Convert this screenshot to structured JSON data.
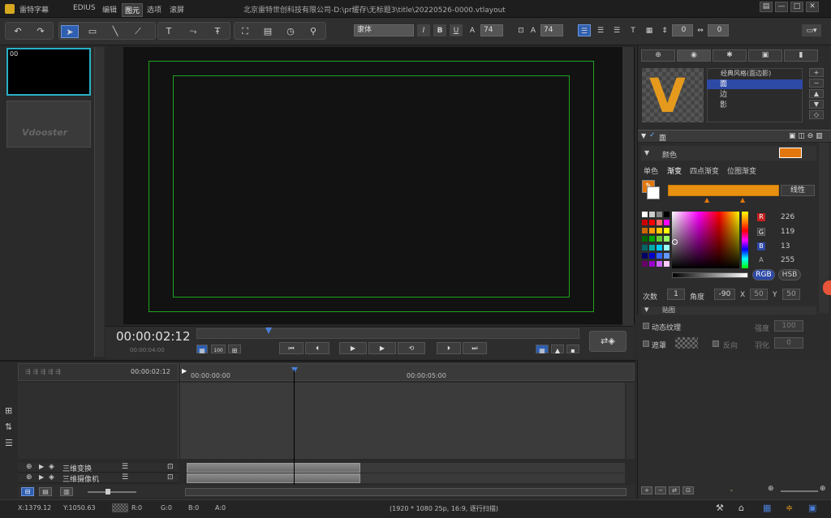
{
  "titlebar": {
    "app_name": "雷特字幕",
    "menus": [
      {
        "label": "EDIUS",
        "active": false
      },
      {
        "label": "编辑",
        "active": false
      },
      {
        "label": "图元",
        "active": true
      },
      {
        "label": "选项",
        "active": false
      },
      {
        "label": "滚屏",
        "active": false
      }
    ],
    "window_title": "北京雷特世创科技有限公司-D:\\pr缓存\\无标题3\\title\\20220526-0000.vtlayout",
    "controls": {
      "menu": "▤",
      "minimize": "—",
      "maximize": "□",
      "close": "✕"
    }
  },
  "toolbar": {
    "font_name": "隶体",
    "font_size": "74",
    "line_size": "74",
    "bold": "B",
    "italic": "I",
    "underline": "U",
    "spacing_value_1": "0",
    "spacing_value_2": "0"
  },
  "thumbnails": {
    "item0_label": "00",
    "item1_logo": "Vdooster"
  },
  "playback": {
    "timecode": "00:00:02:12",
    "timecode_sub": "00:00:04:00"
  },
  "style_panel": {
    "preset_name": "经典风格(面边影)",
    "items": [
      {
        "label": "面",
        "selected": true
      },
      {
        "label": "边",
        "selected": false
      },
      {
        "label": "影",
        "selected": false
      }
    ],
    "thumb_letter": "V"
  },
  "face_panel": {
    "title": "面",
    "color_section": "颜色",
    "tabs": [
      "单色",
      "渐变",
      "四点渐变",
      "位图渐变"
    ],
    "active_tab": "渐变",
    "gradient_type": "线性",
    "accent_color": "#e2770d",
    "r_label": "R",
    "r_value": "226",
    "g_label": "G",
    "g_value": "119",
    "b_label": "B",
    "b_value": "13",
    "a_label": "A",
    "a_value": "255",
    "mode_rgb": "RGB",
    "mode_hsb": "HSB",
    "count_label": "次数",
    "count_value": "1",
    "angle_label": "角度",
    "angle_value": "-90",
    "x_label": "X",
    "x_value": "50",
    "y_label": "Y",
    "y_value": "50",
    "texture_section": "贴图"
  },
  "lower_right": {
    "dynamic_texture": "动态纹理",
    "intensity_label": "强度",
    "intensity_value": "100",
    "mask_label": "遮罩",
    "invert_label": "反向",
    "feather_label": "羽化",
    "feather_value": "0"
  },
  "timeline": {
    "head_timecode": "00:00:02:12",
    "ruler_start": "00:00:00:00",
    "ruler_mid": "00:00:05:00",
    "tracks": [
      {
        "label": "三维变换"
      },
      {
        "label": "三维摄像机"
      }
    ]
  },
  "status": {
    "x": "X:1379.12",
    "y": "Y:1050.63",
    "r": "R:0",
    "g": "G:0",
    "b": "B:0",
    "a": "A:0",
    "format": "(1920 * 1080 25p, 16:9, 逐行扫描)"
  }
}
